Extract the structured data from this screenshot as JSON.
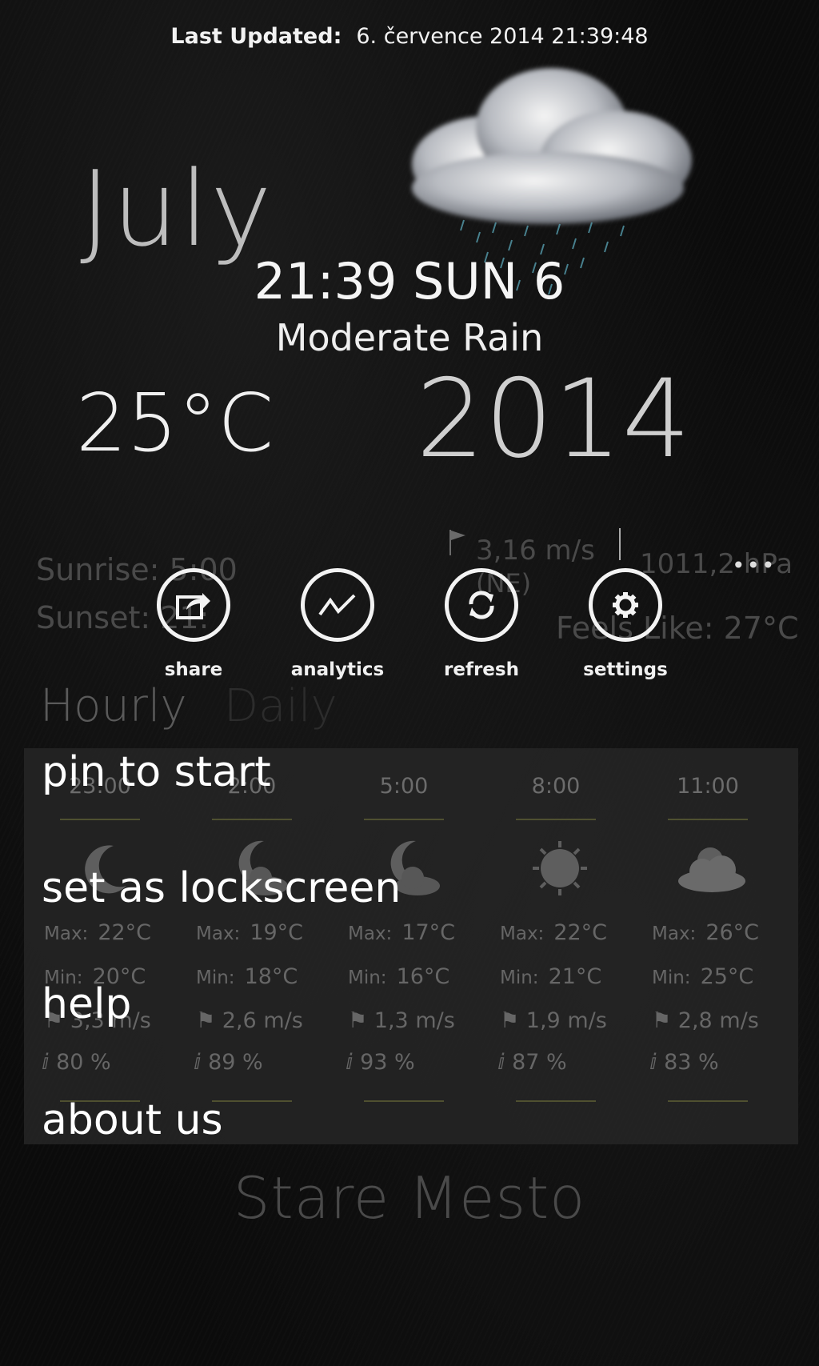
{
  "header": {
    "last_updated_label": "Last Updated:",
    "last_updated_value": "6. července 2014 21:39:48"
  },
  "main": {
    "month": "July",
    "time_day": "21:39 SUN 6",
    "condition": "Moderate Rain",
    "temperature": "25°C",
    "year": "2014",
    "sunrise": "Sunrise: 5:00",
    "sunset": "Sunset: 21:",
    "wind_speed": "3,16 m/s",
    "wind_dir": "(NE)",
    "pressure": "1011,2 hPa",
    "feels_like": "Feels Like: 27°C",
    "more_dots": "•••"
  },
  "appbar": {
    "buttons": [
      {
        "label": "share",
        "icon": "share-icon"
      },
      {
        "label": "analytics",
        "icon": "analytics-icon"
      },
      {
        "label": "refresh",
        "icon": "refresh-icon"
      },
      {
        "label": "settings",
        "icon": "gear-icon"
      }
    ]
  },
  "tabs": {
    "hourly": "Hourly",
    "daily": "Daily"
  },
  "forecast": {
    "max_label": "Max:",
    "min_label": "Min:",
    "columns": [
      {
        "time": "23:00",
        "icon": "moon-icon",
        "max": "22°C",
        "min": "20°C",
        "wind": "3,3 m/s",
        "humidity": "80 %"
      },
      {
        "time": "2:00",
        "icon": "moon-cloud-icon",
        "max": "19°C",
        "min": "18°C",
        "wind": "2,6 m/s",
        "humidity": "89 %"
      },
      {
        "time": "5:00",
        "icon": "moon-cloud-icon",
        "max": "17°C",
        "min": "16°C",
        "wind": "1,3 m/s",
        "humidity": "93 %"
      },
      {
        "time": "8:00",
        "icon": "sun-icon",
        "max": "22°C",
        "min": "21°C",
        "wind": "1,9 m/s",
        "humidity": "87 %"
      },
      {
        "time": "11:00",
        "icon": "sun-cloud-icon",
        "max": "26°C",
        "min": "25°C",
        "wind": "2,8 m/s",
        "humidity": "83 %"
      }
    ]
  },
  "menu": {
    "items": [
      "pin to start",
      "set as lockscreen",
      "help",
      "about us"
    ]
  },
  "location": {
    "city": "Stare Mesto"
  }
}
